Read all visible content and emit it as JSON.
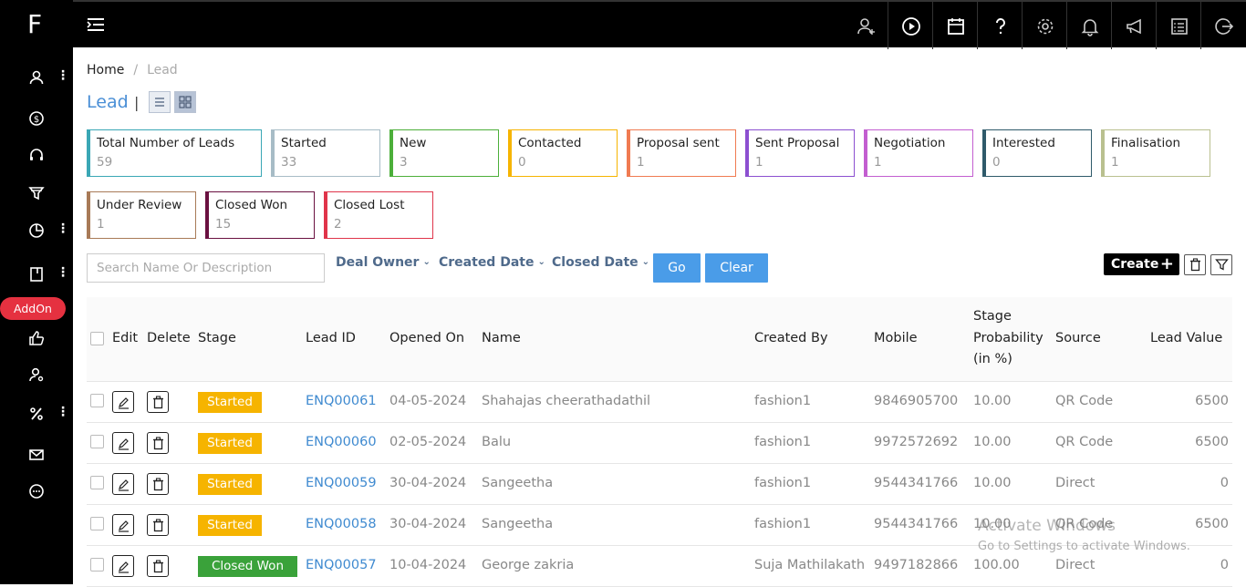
{
  "app": {
    "logo": "F",
    "addon_label": "AddOn"
  },
  "colors": {
    "accent": "#4a9ce8",
    "started": "#f6b400",
    "closed_won": "#3aa23a",
    "addon": "#e53140"
  },
  "breadcrumb": {
    "home": "Home",
    "separator": "/",
    "current": "Lead"
  },
  "page": {
    "title": "Lead",
    "title_separator": "|"
  },
  "cards": [
    {
      "label": "Total Number of Leads",
      "value": "59",
      "color": "#3aa7b5"
    },
    {
      "label": "Started",
      "value": "33",
      "color": "#a7bcc6"
    },
    {
      "label": "New",
      "value": "3",
      "color": "#4caf3a"
    },
    {
      "label": "Contacted",
      "value": "0",
      "color": "#f6b400"
    },
    {
      "label": "Proposal sent",
      "value": "1",
      "color": "#f07b52"
    },
    {
      "label": "Sent Proposal",
      "value": "1",
      "color": "#8c4fd0"
    },
    {
      "label": "Negotiation",
      "value": "1",
      "color": "#c35ed0"
    },
    {
      "label": "Interested",
      "value": "0",
      "color": "#2f5a6a"
    },
    {
      "label": "Finalisation",
      "value": "1",
      "color": "#b9c08f"
    },
    {
      "label": "Under Review",
      "value": "1",
      "color": "#a87a57"
    },
    {
      "label": "Closed Won",
      "value": "15",
      "color": "#6a1040"
    },
    {
      "label": "Closed Lost",
      "value": "2",
      "color": "#e0344a"
    }
  ],
  "filters": {
    "search_placeholder": "Search Name Or Description",
    "deal_owner": "Deal Owner",
    "created_date": "Created Date",
    "closed_date": "Closed Date",
    "go": "Go",
    "clear": "Clear",
    "create": "Create"
  },
  "table": {
    "headers": {
      "edit": "Edit",
      "delete": "Delete",
      "stage": "Stage",
      "lead_id": "Lead ID",
      "opened_on": "Opened On",
      "name": "Name",
      "created_by": "Created By",
      "mobile": "Mobile",
      "probability_1": "Stage",
      "probability_2": "Probability",
      "probability_3": "(in %)",
      "source": "Source",
      "lead_value": "Lead Value"
    },
    "rows": [
      {
        "stage": "Started",
        "lead_id": "ENQ00061",
        "opened_on": "04-05-2024",
        "name": "Shahajas cheerathadathil",
        "created_by": "fashion1",
        "mobile": "9846905700",
        "probability": "10.00",
        "source": "QR Code",
        "value": "6500"
      },
      {
        "stage": "Started",
        "lead_id": "ENQ00060",
        "opened_on": "02-05-2024",
        "name": "Balu",
        "created_by": "fashion1",
        "mobile": "9972572692",
        "probability": "10.00",
        "source": "QR Code",
        "value": "6500"
      },
      {
        "stage": "Started",
        "lead_id": "ENQ00059",
        "opened_on": "30-04-2024",
        "name": "Sangeetha",
        "created_by": "fashion1",
        "mobile": "9544341766",
        "probability": "10.00",
        "source": "Direct",
        "value": "0"
      },
      {
        "stage": "Started",
        "lead_id": "ENQ00058",
        "opened_on": "30-04-2024",
        "name": "Sangeetha",
        "created_by": "fashion1",
        "mobile": "9544341766",
        "probability": "10.00",
        "source": "QR Code",
        "value": "6500"
      },
      {
        "stage": "Closed Won",
        "lead_id": "ENQ00057",
        "opened_on": "10-04-2024",
        "name": "George zakria",
        "created_by": "Suja Mathilakath",
        "mobile": "9497182866",
        "probability": "100.00",
        "source": "Direct",
        "value": "0"
      }
    ]
  },
  "watermark": {
    "line1": "Activate Windows",
    "line2": "Go to Settings to activate Windows."
  }
}
